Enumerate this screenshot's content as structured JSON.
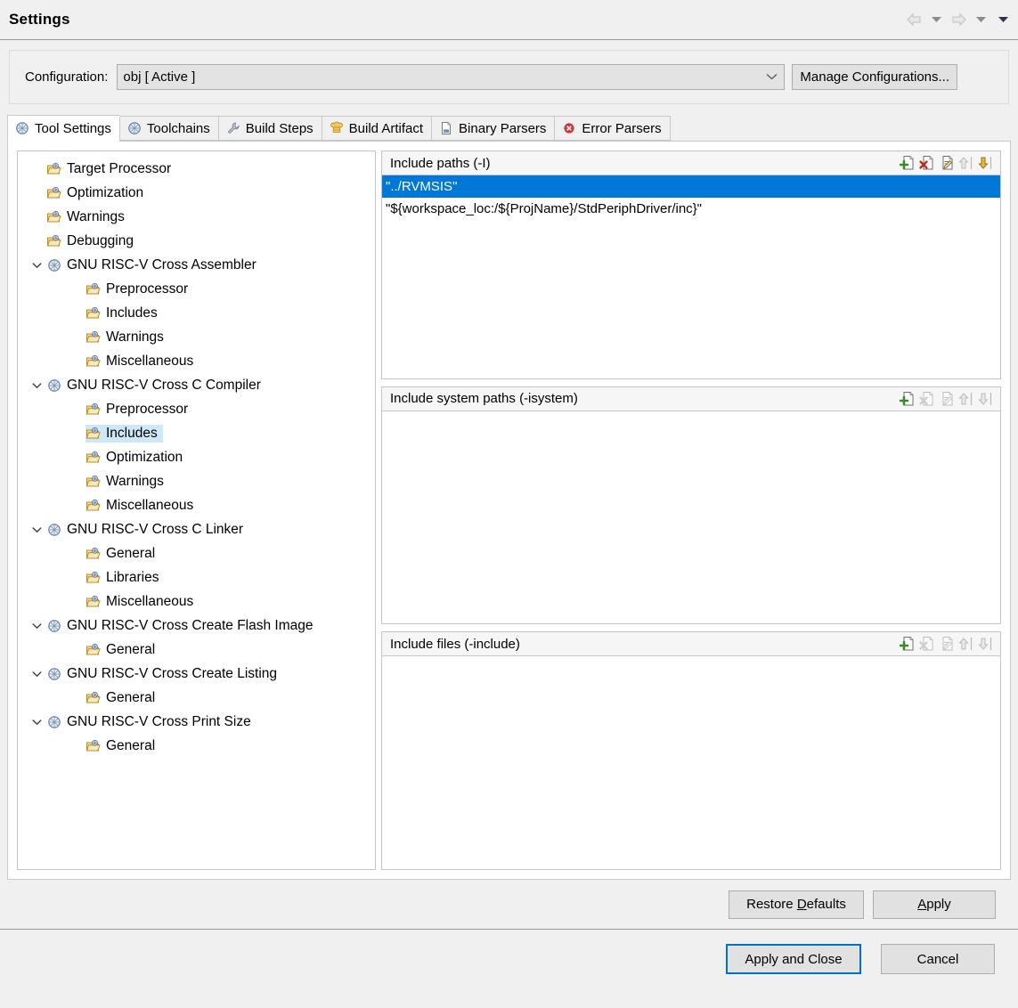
{
  "window": {
    "title": "Settings",
    "nav": [
      {
        "name": "back-arrow-icon",
        "glyph": "back"
      },
      {
        "name": "back-dropdown-icon",
        "glyph": "caret"
      },
      {
        "name": "forward-arrow-icon",
        "glyph": "forward"
      },
      {
        "name": "forward-dropdown-icon",
        "glyph": "caret"
      },
      {
        "name": "menu-dropdown-icon",
        "glyph": "caret-dark"
      }
    ]
  },
  "configuration": {
    "label": "Configuration:",
    "value": "obj  [ Active ]",
    "manage_button": "Manage Configurations..."
  },
  "tabs": [
    {
      "label": "Tool Settings",
      "icon": "gear-globe-icon",
      "active": true
    },
    {
      "label": "Toolchains",
      "icon": "gear-globe-icon",
      "active": false
    },
    {
      "label": "Build Steps",
      "icon": "wrench-icon",
      "active": false
    },
    {
      "label": "Build Artifact",
      "icon": "chef-hat-icon",
      "active": false
    },
    {
      "label": "Binary Parsers",
      "icon": "binary-file-icon",
      "active": false
    },
    {
      "label": "Error Parsers",
      "icon": "error-circle-icon",
      "active": false
    }
  ],
  "tree": [
    {
      "label": "Target Processor",
      "level": 1,
      "icon": "folder-gear-icon",
      "twisty": "",
      "selected": false
    },
    {
      "label": "Optimization",
      "level": 1,
      "icon": "folder-gear-icon",
      "twisty": "",
      "selected": false
    },
    {
      "label": "Warnings",
      "level": 1,
      "icon": "folder-gear-icon",
      "twisty": "",
      "selected": false
    },
    {
      "label": "Debugging",
      "level": 1,
      "icon": "folder-gear-icon",
      "twisty": "",
      "selected": false
    },
    {
      "label": "GNU RISC-V Cross Assembler",
      "level": 0,
      "icon": "gear-globe-icon",
      "twisty": "expanded",
      "selected": false
    },
    {
      "label": "Preprocessor",
      "level": 2,
      "icon": "folder-gear-icon",
      "twisty": "",
      "selected": false
    },
    {
      "label": "Includes",
      "level": 2,
      "icon": "folder-gear-icon",
      "twisty": "",
      "selected": false
    },
    {
      "label": "Warnings",
      "level": 2,
      "icon": "folder-gear-icon",
      "twisty": "",
      "selected": false
    },
    {
      "label": "Miscellaneous",
      "level": 2,
      "icon": "folder-gear-icon",
      "twisty": "",
      "selected": false
    },
    {
      "label": "GNU RISC-V Cross C Compiler",
      "level": 0,
      "icon": "gear-globe-icon",
      "twisty": "expanded",
      "selected": false
    },
    {
      "label": "Preprocessor",
      "level": 2,
      "icon": "folder-gear-icon",
      "twisty": "",
      "selected": false
    },
    {
      "label": "Includes",
      "level": 2,
      "icon": "folder-gear-icon",
      "twisty": "",
      "selected": true
    },
    {
      "label": "Optimization",
      "level": 2,
      "icon": "folder-gear-icon",
      "twisty": "",
      "selected": false
    },
    {
      "label": "Warnings",
      "level": 2,
      "icon": "folder-gear-icon",
      "twisty": "",
      "selected": false
    },
    {
      "label": "Miscellaneous",
      "level": 2,
      "icon": "folder-gear-icon",
      "twisty": "",
      "selected": false
    },
    {
      "label": "GNU RISC-V Cross C Linker",
      "level": 0,
      "icon": "gear-globe-icon",
      "twisty": "expanded",
      "selected": false
    },
    {
      "label": "General",
      "level": 2,
      "icon": "folder-gear-icon",
      "twisty": "",
      "selected": false
    },
    {
      "label": "Libraries",
      "level": 2,
      "icon": "folder-gear-icon",
      "twisty": "",
      "selected": false
    },
    {
      "label": "Miscellaneous",
      "level": 2,
      "icon": "folder-gear-icon",
      "twisty": "",
      "selected": false
    },
    {
      "label": "GNU RISC-V Cross Create Flash Image",
      "level": 0,
      "icon": "gear-globe-icon",
      "twisty": "expanded",
      "selected": false
    },
    {
      "label": "General",
      "level": 2,
      "icon": "folder-gear-icon",
      "twisty": "",
      "selected": false
    },
    {
      "label": "GNU RISC-V Cross Create Listing",
      "level": 0,
      "icon": "gear-globe-icon",
      "twisty": "expanded",
      "selected": false
    },
    {
      "label": "General",
      "level": 2,
      "icon": "folder-gear-icon",
      "twisty": "",
      "selected": false
    },
    {
      "label": "GNU RISC-V Cross Print Size",
      "level": 0,
      "icon": "gear-globe-icon",
      "twisty": "expanded",
      "selected": false
    },
    {
      "label": "General",
      "level": 2,
      "icon": "folder-gear-icon",
      "twisty": "",
      "selected": false
    }
  ],
  "panels": [
    {
      "title": "Include paths (-I)",
      "tools": [
        {
          "name": "add-icon",
          "enabled": true
        },
        {
          "name": "delete-icon",
          "enabled": true
        },
        {
          "name": "edit-icon",
          "enabled": true
        },
        {
          "name": "move-up-icon",
          "enabled": false
        },
        {
          "name": "move-down-icon",
          "enabled": true
        }
      ],
      "items": [
        {
          "value": "\"../RVMSIS\"",
          "selected": true
        },
        {
          "value": "\"${workspace_loc:/${ProjName}/StdPeriphDriver/inc}\"",
          "selected": false
        }
      ]
    },
    {
      "title": "Include system paths (-isystem)",
      "tools": [
        {
          "name": "add-icon",
          "enabled": true
        },
        {
          "name": "delete-icon",
          "enabled": false
        },
        {
          "name": "edit-icon",
          "enabled": false
        },
        {
          "name": "move-up-icon",
          "enabled": false
        },
        {
          "name": "move-down-icon",
          "enabled": false
        }
      ],
      "items": []
    },
    {
      "title": "Include files (-include)",
      "tools": [
        {
          "name": "add-icon",
          "enabled": true
        },
        {
          "name": "delete-icon",
          "enabled": false
        },
        {
          "name": "edit-icon",
          "enabled": false
        },
        {
          "name": "move-up-icon",
          "enabled": false
        },
        {
          "name": "move-down-icon",
          "enabled": false
        }
      ],
      "items": []
    }
  ],
  "buttons": {
    "restore_defaults": "Restore Defaults",
    "restore_defaults_mnemonic": "D",
    "apply": "Apply",
    "apply_mnemonic": "A",
    "apply_and_close": "Apply and Close",
    "cancel": "Cancel"
  },
  "colors": {
    "selection_blue": "#0078d7",
    "tree_selection": "#cde8f8",
    "focus_border": "#0072c6",
    "dialog_bg": "#f0f0f0"
  }
}
